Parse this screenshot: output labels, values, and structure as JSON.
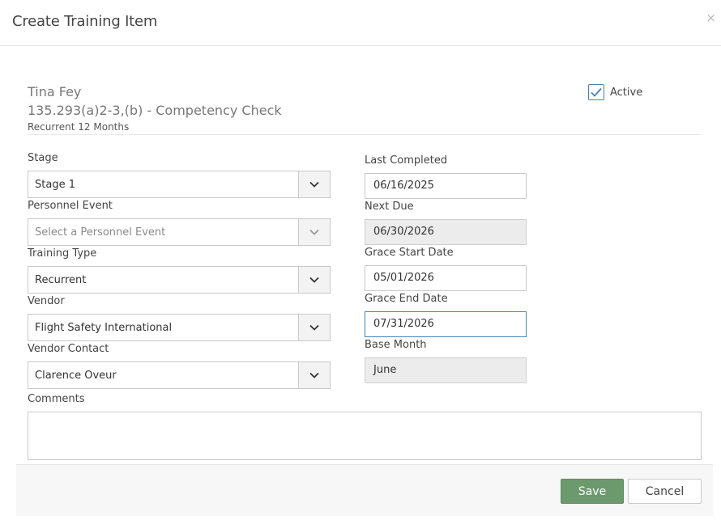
{
  "dialog": {
    "title": "Create Training Item",
    "close_glyph": "×"
  },
  "info": {
    "person": "Tina Fey",
    "item": "135.293(a)2-3,(b) - Competency Check",
    "recurrence": "Recurrent 12 Months"
  },
  "active": {
    "label": "Active",
    "checked": true
  },
  "left_fields": {
    "stage": {
      "label": "Stage",
      "value": "Stage 1"
    },
    "personnel_event": {
      "label": "Personnel Event",
      "placeholder": "Select a Personnel Event"
    },
    "training_type": {
      "label": "Training Type",
      "value": "Recurrent"
    },
    "vendor": {
      "label": "Vendor",
      "value": "Flight Safety International"
    },
    "vendor_contact": {
      "label": "Vendor Contact",
      "value": "Clarence Oveur"
    }
  },
  "right_fields": {
    "last_completed": {
      "label": "Last Completed",
      "value": "06/16/2025"
    },
    "next_due": {
      "label": "Next Due",
      "value": "06/30/2026"
    },
    "grace_start": {
      "label": "Grace Start Date",
      "value": "05/01/2026"
    },
    "grace_end": {
      "label": "Grace End Date",
      "value": "07/31/2026"
    },
    "base_month": {
      "label": "Base Month",
      "value": "June"
    }
  },
  "comments": {
    "label": "Comments",
    "value": ""
  },
  "footer": {
    "save_label": "Save",
    "cancel_label": "Cancel"
  },
  "colors": {
    "accent": "#4a7fb5",
    "save_button": "#6c9a6e",
    "readonly_field": "#ececec"
  }
}
